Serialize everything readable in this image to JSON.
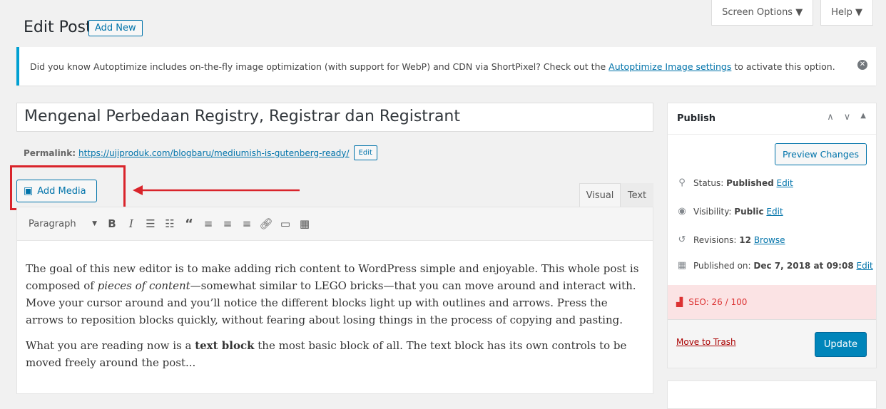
{
  "header": {
    "title": "Edit Post",
    "add_new_label": "Add New",
    "screen_options_label": "Screen Options ▼",
    "help_label": "Help ▼"
  },
  "notice": {
    "text_before": "Did you know Autoptimize includes on-the-fly image optimization (with support for WebP) and CDN via ShortPixel? Check out the ",
    "link_text": "Autoptimize Image settings",
    "text_after": " to activate this option.",
    "close_icon": "dismiss-icon"
  },
  "editor": {
    "title_value": "Mengenal Perbedaan Registry, Registrar dan Registrant",
    "permalink_label": "Permalink:",
    "permalink_url": "https://ujiproduk.com/blogbaru/mediumish-is-gutenberg-ready/",
    "permalink_edit": "Edit",
    "add_media_label": "Add Media",
    "tab_visual": "Visual",
    "tab_text": "Text",
    "format_value": "Paragraph",
    "toolbar_icons": [
      "bold-icon",
      "italic-icon",
      "bullet-list-icon",
      "numbered-list-icon",
      "blockquote-icon",
      "align-left-icon",
      "align-center-icon",
      "align-right-icon",
      "link-icon",
      "read-more-icon",
      "toolbar-toggle-icon"
    ],
    "content": {
      "p1_a": "The goal of this new editor is to make adding rich content to WordPress simple and enjoyable. This whole post is composed of ",
      "p1_em": "pieces of content",
      "p1_b": "—somewhat similar to LEGO bricks—that you can move around and interact with. Move your cursor around and you’ll notice the different blocks light up with outlines and arrows. Press the arrows to reposition blocks quickly, without fearing about losing things in the process of copying and pasting.",
      "p2_a": "What you are reading now is a ",
      "p2_strong": "text block",
      "p2_b": " the most basic block of all. The text block has its own controls to be moved freely around the post..."
    }
  },
  "publish": {
    "title": "Publish",
    "preview_label": "Preview Changes",
    "status_label": "Status:",
    "status_value": "Published",
    "status_edit": "Edit",
    "visibility_label": "Visibility:",
    "visibility_value": "Public",
    "visibility_edit": "Edit",
    "revisions_label": "Revisions:",
    "revisions_value": "12",
    "revisions_link": "Browse",
    "published_label": "Published on:",
    "published_value": "Dec 7, 2018 at 09:08",
    "published_edit": "Edit",
    "seo_label": "SEO: 26 / 100",
    "trash_label": "Move to Trash",
    "update_label": "Update"
  },
  "colors": {
    "accent": "#0073aa",
    "highlight": "#d9242b",
    "seo_bg": "#fbe3e4"
  }
}
